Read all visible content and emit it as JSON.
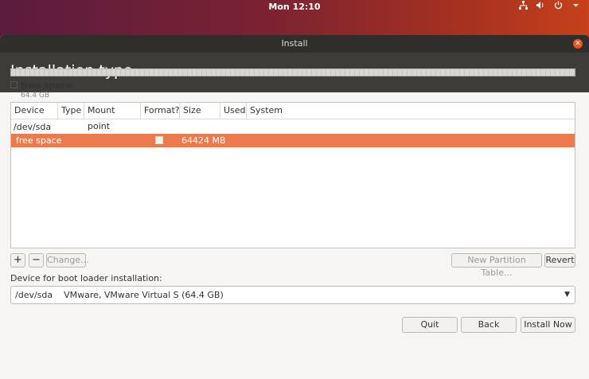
{
  "topbar": {
    "clock": "Mon 12:10",
    "icons": [
      "network-icon",
      "volume-icon",
      "power-icon",
      "chevron-down-icon"
    ]
  },
  "window": {
    "title": "Install",
    "heading": "Installation type"
  },
  "legend": {
    "name": "free space",
    "size": "64.4 GB"
  },
  "table": {
    "columns": [
      "Device",
      "Type",
      "Mount point",
      "Format?",
      "Size",
      "Used",
      "System"
    ],
    "device": "/dev/sda",
    "rows": [
      {
        "device": "free space",
        "type": "",
        "mount": "",
        "format": false,
        "size": "64424 MB",
        "used": "",
        "system": ""
      }
    ]
  },
  "actions": {
    "add": "+",
    "remove": "−",
    "change": "Change...",
    "new_partition_table": "New Partition Table...",
    "revert": "Revert"
  },
  "bootloader": {
    "label": "Device for boot loader installation:",
    "selected": "/dev/sda    VMware, VMware Virtual S (64.4 GB)"
  },
  "footer": {
    "quit": "Quit",
    "back": "Back",
    "install": "Install Now"
  },
  "colors": {
    "accent": "#e95420",
    "selected_row": "#ec7a4d",
    "header_bg": "#3d3c38"
  }
}
